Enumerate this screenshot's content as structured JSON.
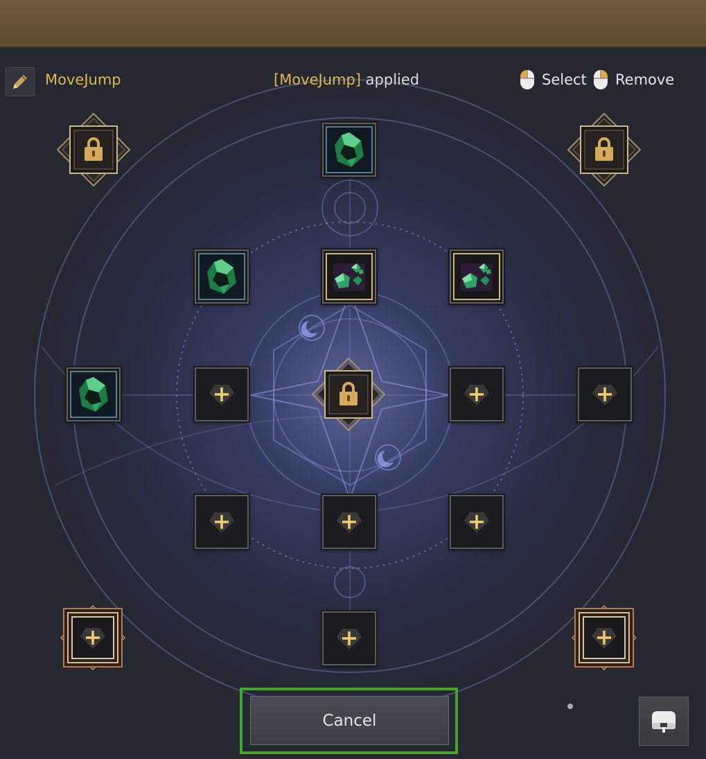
{
  "header": {
    "preset_name": "MoveJump",
    "applied_name": "[MoveJump]",
    "applied_suffix": " applied",
    "select_label": "Select",
    "remove_label": "Remove"
  },
  "icons": {
    "edit": "pencil-icon",
    "select": "mouse-left-click-icon",
    "remove": "mouse-right-click-icon",
    "lock": "padlock-icon",
    "empty": "plus-gem-socket-icon",
    "gem": "emerald-gem-icon",
    "gem_cluster": "emerald-gem-cluster-icon",
    "corner": "tray-icon"
  },
  "slots": [
    {
      "id": "top-left",
      "state": "locked"
    },
    {
      "id": "top-center",
      "state": "gem"
    },
    {
      "id": "top-right",
      "state": "locked"
    },
    {
      "id": "upper-left",
      "state": "gem"
    },
    {
      "id": "upper-center",
      "state": "gem-cluster"
    },
    {
      "id": "upper-right",
      "state": "gem-cluster"
    },
    {
      "id": "middle-far-left",
      "state": "gem"
    },
    {
      "id": "middle-left",
      "state": "empty"
    },
    {
      "id": "center",
      "state": "locked"
    },
    {
      "id": "middle-right",
      "state": "empty"
    },
    {
      "id": "middle-far-right",
      "state": "empty"
    },
    {
      "id": "lower-left",
      "state": "empty"
    },
    {
      "id": "lower-center",
      "state": "empty"
    },
    {
      "id": "lower-right",
      "state": "empty"
    },
    {
      "id": "bottom-left",
      "state": "empty-ornate"
    },
    {
      "id": "bottom-center",
      "state": "empty"
    },
    {
      "id": "bottom-right",
      "state": "empty-ornate"
    }
  ],
  "footer": {
    "cancel_label": "Cancel"
  },
  "colors": {
    "accent_gold": "#e1b552",
    "lock_gold": "#d5aa5f",
    "focus_outline": "#46a62a",
    "gem_green": "#2f9a5a"
  }
}
